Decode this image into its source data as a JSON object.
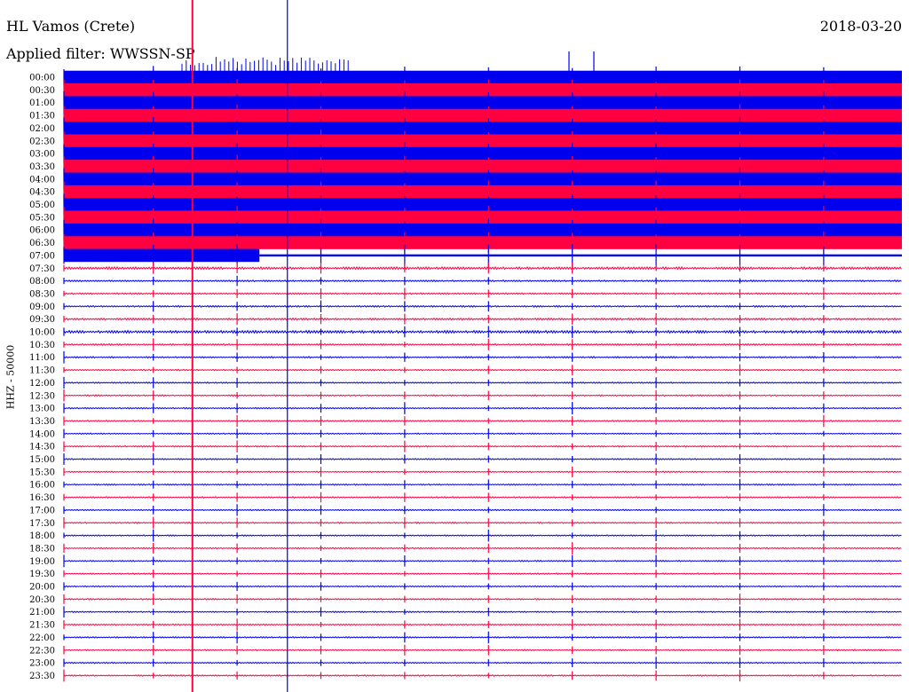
{
  "header": {
    "station": "HL Vamos (Crete)",
    "date": "2018-03-20",
    "filter": "Applied filter: WWSSN-SP"
  },
  "ylabel": "HHZ - 50000",
  "colors": {
    "odd_trace": "#0000ee",
    "even_trace": "#ff0040",
    "marker_a": "#ff0040",
    "marker_b": "#0000ee"
  },
  "chart_data": {
    "type": "line",
    "rows": [
      "00:00",
      "00:30",
      "01:00",
      "01:30",
      "02:00",
      "02:30",
      "03:00",
      "03:30",
      "04:00",
      "04:30",
      "05:00",
      "05:30",
      "06:00",
      "06:30",
      "07:00",
      "07:30",
      "08:00",
      "08:30",
      "09:00",
      "09:30",
      "10:00",
      "10:30",
      "11:00",
      "11:30",
      "12:00",
      "12:30",
      "13:00",
      "13:30",
      "14:00",
      "14:30",
      "15:00",
      "15:30",
      "16:00",
      "16:30",
      "17:00",
      "17:30",
      "18:00",
      "18:30",
      "19:00",
      "19:30",
      "20:00",
      "20:30",
      "21:00",
      "21:30",
      "22:00",
      "22:30",
      "23:00",
      "23:30"
    ],
    "minutes_per_row": 30,
    "saturated_until": "07:07",
    "row_amplitude": [
      1,
      1,
      1,
      1,
      1,
      1,
      1,
      1,
      1,
      1,
      1,
      1,
      1,
      1,
      1,
      0.18,
      0.12,
      0.12,
      0.12,
      0.14,
      0.2,
      0.12,
      0.12,
      0.1,
      0.1,
      0.1,
      0.1,
      0.1,
      0.1,
      0.1,
      0.1,
      0.1,
      0.1,
      0.1,
      0.1,
      0.1,
      0.1,
      0.1,
      0.1,
      0.1,
      0.1,
      0.1,
      0.1,
      0.1,
      0.1,
      0.1,
      0.1,
      0.1
    ],
    "marker_lines_minutes": [
      4.6,
      8.0
    ],
    "spike_minutes": [
      0,
      3.2,
      6.2,
      9.2,
      12.2,
      15.2,
      18.2,
      21.2,
      24.2,
      27.2
    ]
  }
}
